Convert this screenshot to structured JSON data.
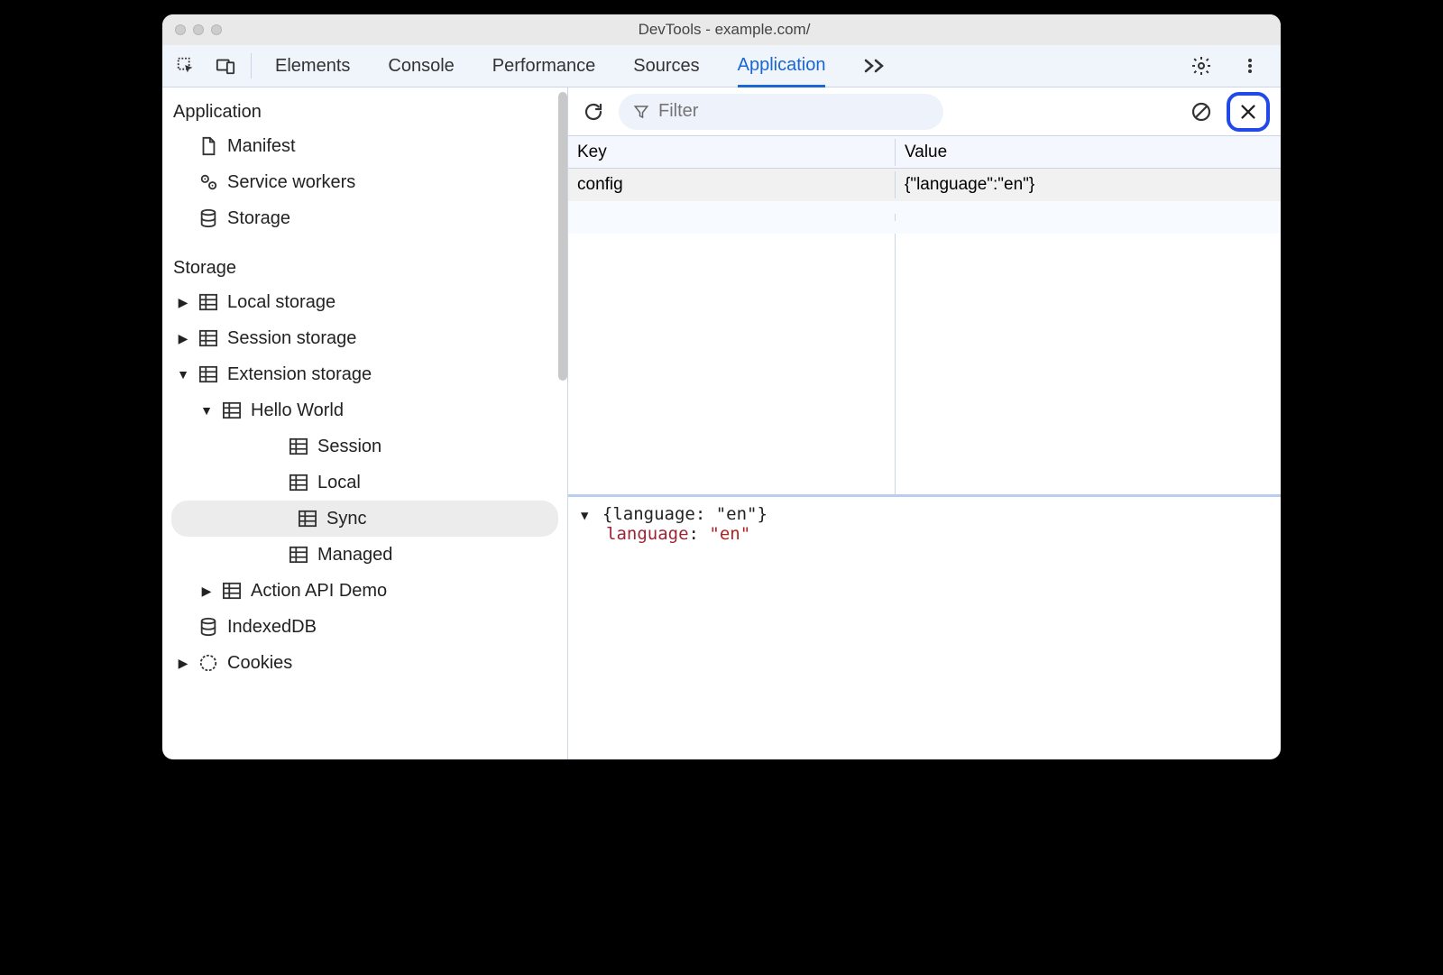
{
  "window": {
    "title": "DevTools - example.com/"
  },
  "tabs": {
    "elements": "Elements",
    "console": "Console",
    "performance": "Performance",
    "sources": "Sources",
    "application": "Application"
  },
  "sidebar": {
    "application_header": "Application",
    "manifest": "Manifest",
    "service_workers": "Service workers",
    "storage_item": "Storage",
    "storage_header": "Storage",
    "local_storage": "Local storage",
    "session_storage": "Session storage",
    "extension_storage": "Extension storage",
    "hello_world": "Hello World",
    "session": "Session",
    "local": "Local",
    "sync": "Sync",
    "managed": "Managed",
    "action_api_demo": "Action API Demo",
    "indexeddb": "IndexedDB",
    "cookies": "Cookies"
  },
  "toolbar": {
    "filter_placeholder": "Filter"
  },
  "table": {
    "key_header": "Key",
    "value_header": "Value",
    "rows": [
      {
        "key": "config",
        "value": "{\"language\":\"en\"}"
      }
    ]
  },
  "preview": {
    "summary": "{language: \"en\"}",
    "key": "language",
    "sep": ": ",
    "value": "\"en\""
  }
}
